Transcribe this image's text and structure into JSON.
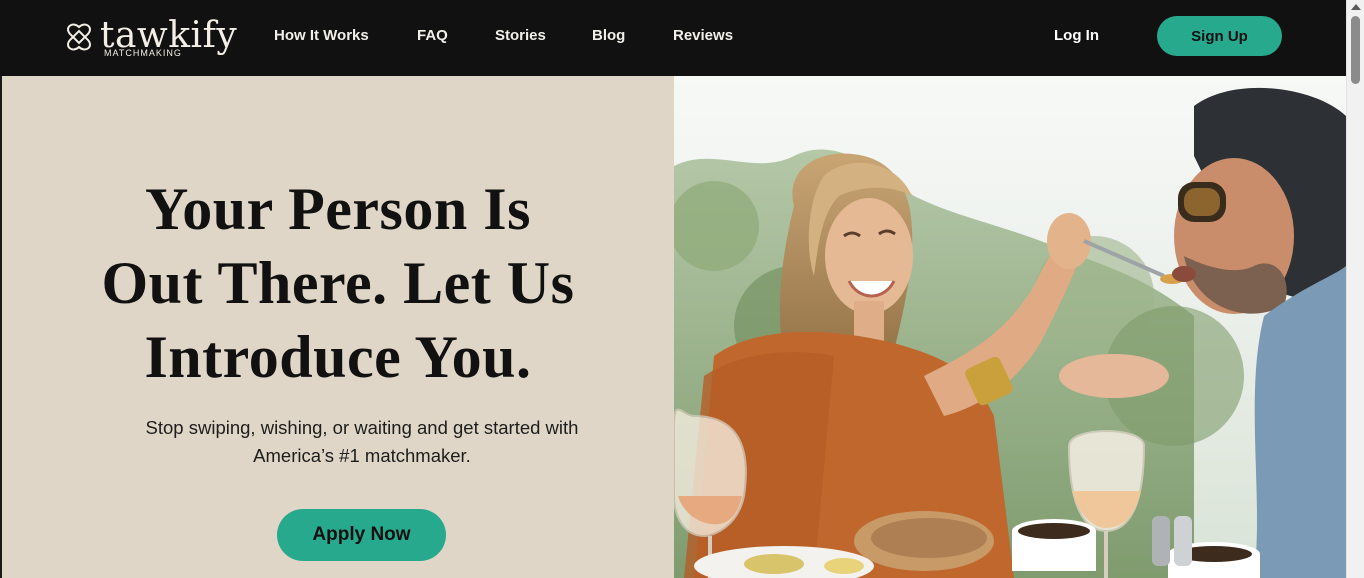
{
  "brand": {
    "name": "tawkify",
    "tagline": "MATCHMAKING",
    "logo_icon": "interlocking-hearts-icon"
  },
  "nav": {
    "links": [
      "How It Works",
      "FAQ",
      "Stories",
      "Blog",
      "Reviews"
    ],
    "login_label": "Log In",
    "signup_label": "Sign Up"
  },
  "hero": {
    "title_lines": [
      "Your Person Is",
      "Out There. Let Us",
      "Introduce You."
    ],
    "subtitle_lines": [
      "Stop swiping, wishing, or waiting and get started with",
      "America’s #1 matchmaker."
    ],
    "cta_label": "Apply Now"
  },
  "colors": {
    "nav_bg": "#111111",
    "accent": "#27a98d",
    "hero_bg": "#dfd6c7",
    "text_dark": "#111111"
  }
}
